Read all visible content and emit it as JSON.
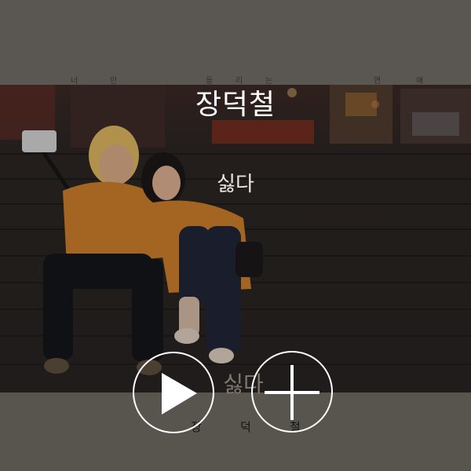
{
  "header": {
    "artist_name": "장덕철",
    "track_name": "싫다"
  },
  "album_art": {
    "top_lyric_chars": [
      "너",
      "만",
      "들",
      "리",
      "는",
      "연",
      "애"
    ],
    "title_text": "싫다",
    "artist_chars": [
      "장",
      "덕",
      "철"
    ]
  },
  "controls": {
    "play_icon": "play-icon",
    "add_icon": "plus-icon"
  },
  "colors": {
    "background": "#595651",
    "icon_stroke": "#ffffff",
    "shirt_orange": "#c97a2a"
  }
}
